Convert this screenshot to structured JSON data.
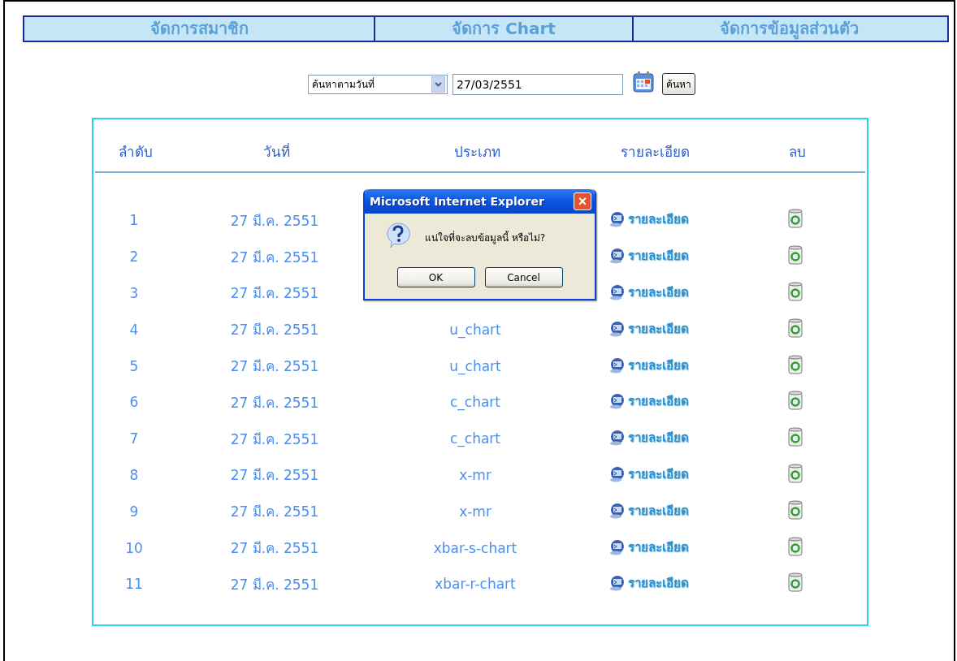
{
  "nav": [
    {
      "label": "จัดการสมาชิก"
    },
    {
      "label": "จัดการ Chart"
    },
    {
      "label": "จัดการข้อมูลส่วนตัว"
    }
  ],
  "search": {
    "mode": "ค้นหาตามวันที่",
    "date": "27/03/2551",
    "button": "ค้นหา"
  },
  "table": {
    "columns": [
      "ลำดับ",
      "วันที่",
      "ประเภท",
      "รายละเอียด",
      "ลบ"
    ],
    "rows": [
      {
        "no": "1",
        "date": "27 มี.ค. 2551",
        "detail": "รายละเอียด"
      },
      {
        "no": "2",
        "date": "27 มี.ค. 2551",
        "detail": "รายละเอียด"
      },
      {
        "no": "3",
        "date": "27 มี.ค. 2551",
        "detail": "รายละเอียด"
      },
      {
        "no": "4",
        "date": "27 มี.ค. 2551",
        "type": "u_chart",
        "detail": "รายละเอียด"
      },
      {
        "no": "5",
        "date": "27 มี.ค. 2551",
        "type": "u_chart",
        "detail": "รายละเอียด"
      },
      {
        "no": "6",
        "date": "27 มี.ค. 2551",
        "type": "c_chart",
        "detail": "รายละเอียด"
      },
      {
        "no": "7",
        "date": "27 มี.ค. 2551",
        "type": "c_chart",
        "detail": "รายละเอียด"
      },
      {
        "no": "8",
        "date": "27 มี.ค. 2551",
        "type": "x-mr",
        "detail": "รายละเอียด"
      },
      {
        "no": "9",
        "date": "27 มี.ค. 2551",
        "type": "x-mr",
        "detail": "รายละเอียด"
      },
      {
        "no": "10",
        "date": "27 มี.ค. 2551",
        "type": "xbar-s-chart",
        "detail": "รายละเอียด"
      },
      {
        "no": "11",
        "date": "27 มี.ค. 2551",
        "type": "xbar-r-chart",
        "detail": "รายละเอียด"
      }
    ]
  },
  "dialog": {
    "title": "Microsoft Internet Explorer",
    "close": "×",
    "message": "แน่ใจที่จะลบข้อมูลนี้ หรือไม่?",
    "buttons": [
      "OK",
      "Cancel"
    ]
  }
}
